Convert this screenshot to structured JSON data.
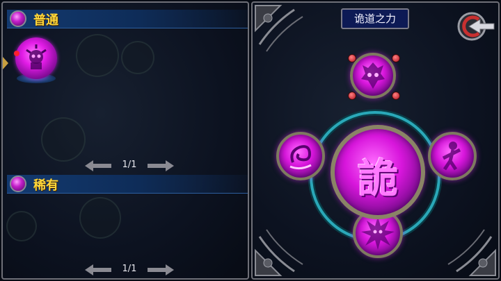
{
  "left_panel": {
    "sections": [
      {
        "title": "普通",
        "page": "1/1",
        "items": [
          {
            "icon": "demon-skull-orb",
            "has_alert": true
          }
        ]
      },
      {
        "title": "稀有",
        "page": "1/1",
        "items": []
      }
    ]
  },
  "right_panel": {
    "title": "诡道之力",
    "center_char": "詭",
    "skills": [
      {
        "position": "top",
        "icon": "demon-mask-icon"
      },
      {
        "position": "left",
        "icon": "swirl-wind-icon"
      },
      {
        "position": "right",
        "icon": "warrior-figure-icon"
      },
      {
        "position": "bottom",
        "icon": "burst-demon-icon"
      }
    ]
  },
  "colors": {
    "accent_magenta": "#e21ce6",
    "header_gold": "#ffd83a",
    "header_blue": "#133a70",
    "ring_teal": "#2aa8b8",
    "border_gray": "#6f7078"
  }
}
